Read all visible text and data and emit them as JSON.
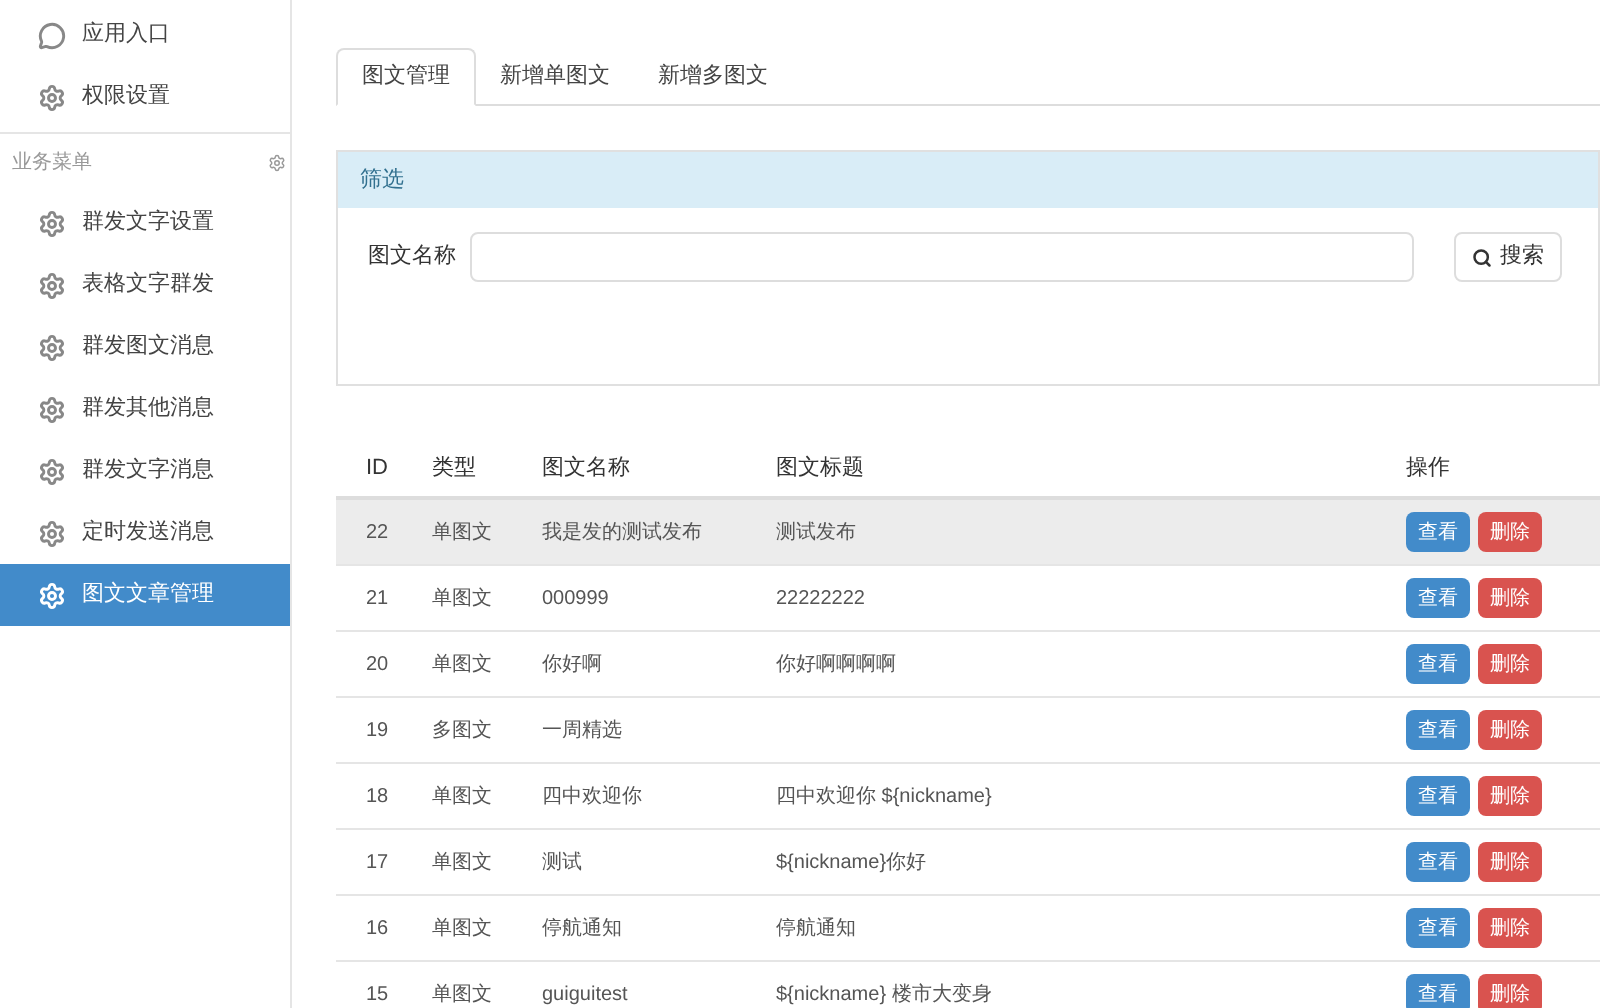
{
  "sidebar": {
    "top_items": [
      {
        "label": "应用入口",
        "selected": false
      },
      {
        "label": "权限设置",
        "selected": false
      }
    ],
    "section": {
      "title": "业务菜单"
    },
    "items": [
      {
        "label": "群发文字设置",
        "selected": false
      },
      {
        "label": "表格文字群发",
        "selected": false
      },
      {
        "label": "群发图文消息",
        "selected": false
      },
      {
        "label": "群发其他消息",
        "selected": false
      },
      {
        "label": "群发文字消息",
        "selected": false
      },
      {
        "label": "定时发送消息",
        "selected": false
      },
      {
        "label": "图文文章管理",
        "selected": true
      }
    ]
  },
  "tabs": [
    {
      "label": "图文管理",
      "selected": true
    },
    {
      "label": "新增单图文",
      "selected": false
    },
    {
      "label": "新增多图文",
      "selected": false
    }
  ],
  "filter": {
    "title": "筛选",
    "field_label": "图文名称",
    "search_button": "搜索"
  },
  "table": {
    "columns": [
      "ID",
      "类型",
      "图文名称",
      "图文标题",
      "操作"
    ],
    "rows": [
      {
        "cells": [
          "22",
          "单图文",
          "我是发的测试发布",
          "测试发布"
        ],
        "highlighted": true,
        "actions": [
          "查看",
          "删除"
        ]
      },
      {
        "cells": [
          "21",
          "单图文",
          "000999",
          "22222222"
        ],
        "highlighted": false,
        "actions": [
          "查看",
          "删除"
        ]
      },
      {
        "cells": [
          "20",
          "单图文",
          "你好啊",
          "你好啊啊啊啊"
        ],
        "highlighted": false,
        "actions": [
          "查看",
          "删除"
        ]
      },
      {
        "cells": [
          "19",
          "多图文",
          "一周精选",
          ""
        ],
        "highlighted": false,
        "actions": [
          "查看",
          "删除"
        ]
      },
      {
        "cells": [
          "18",
          "单图文",
          "四中欢迎你",
          "四中欢迎你 ${nickname}"
        ],
        "highlighted": false,
        "actions": [
          "查看",
          "删除"
        ]
      },
      {
        "cells": [
          "17",
          "单图文",
          "测试",
          "${nickname}你好"
        ],
        "highlighted": false,
        "actions": [
          "查看",
          "删除"
        ]
      },
      {
        "cells": [
          "16",
          "单图文",
          "停航通知",
          "停航通知"
        ],
        "highlighted": false,
        "actions": [
          "查看",
          "删除"
        ]
      },
      {
        "cells": [
          "15",
          "单图文",
          "guiguitest",
          "${nickname} 楼市大变身"
        ],
        "highlighted": false,
        "actions": [
          "查看",
          "删除"
        ]
      }
    ]
  }
}
